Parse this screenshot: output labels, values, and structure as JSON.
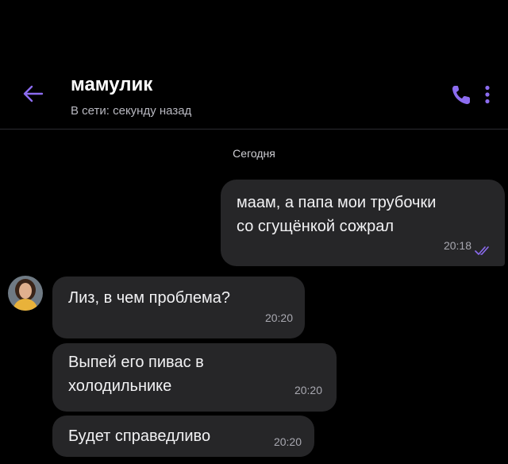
{
  "header": {
    "contact_name": "мамулик",
    "status": "В сети: секунду назад"
  },
  "date_separator": "Сегодня",
  "messages": [
    {
      "direction": "outgoing",
      "lines": [
        "маам, а папа мои трубочки",
        "со сгущёнкой сожрал"
      ],
      "time": "20:18",
      "read": true
    },
    {
      "direction": "incoming",
      "lines": [
        "Лиз, в чем проблема?"
      ],
      "time": "20:20"
    },
    {
      "direction": "incoming",
      "lines": [
        "Выпей его пивас в",
        "холодильнике"
      ],
      "time": "20:20"
    },
    {
      "direction": "incoming",
      "lines": [
        "Будет справедливо"
      ],
      "time": "20:20"
    }
  ],
  "colors": {
    "accent": "#8c6cf0",
    "bubble": "#262628",
    "background": "#000000"
  },
  "icons": {
    "back": "arrow-left-icon",
    "call": "phone-icon",
    "menu": "more-vertical-icon",
    "read": "double-check-icon"
  }
}
